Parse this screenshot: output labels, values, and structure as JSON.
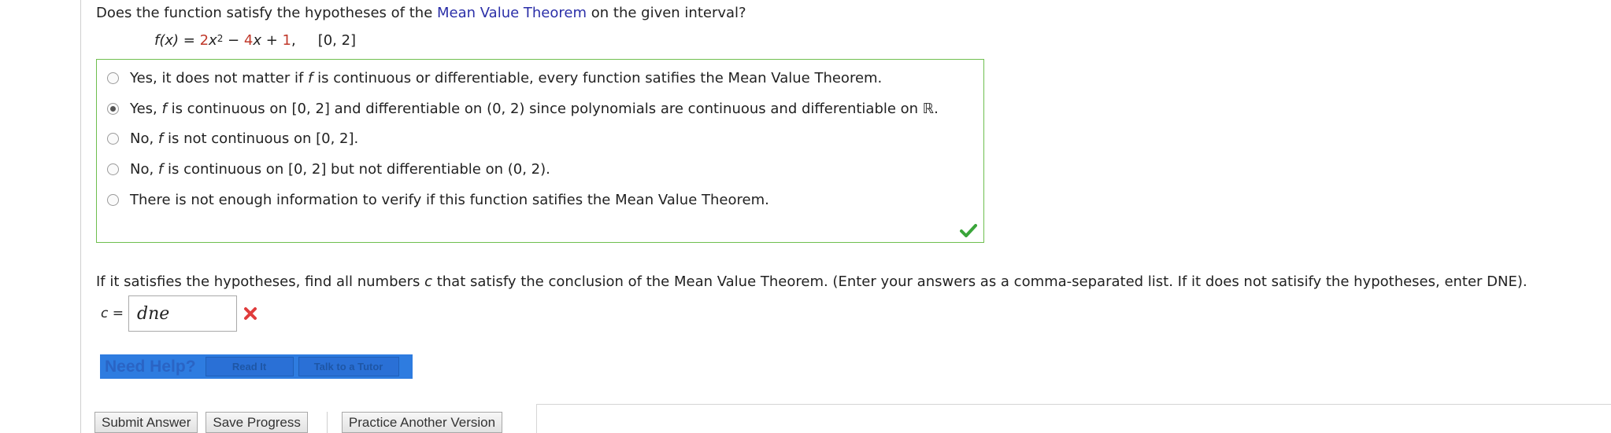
{
  "question": {
    "prefix": "Does the function satisfy the hypotheses of the ",
    "link_text": "Mean Value Theorem",
    "suffix": " on the given interval?"
  },
  "formula": {
    "fx": "f(x)",
    "eq": " = ",
    "coef1": "2",
    "var1": "x",
    "exp": "2",
    "op1": " − ",
    "coef2": "4",
    "var2": "x",
    "op2": " + ",
    "const": "1",
    "comma": ",",
    "interval": "[0, 2]"
  },
  "choices": [
    {
      "pre": "Yes, it does not matter if ",
      "f": "f",
      "post": " is continuous or differentiable, every function satifies the Mean Value Theorem.",
      "selected": false
    },
    {
      "pre": "Yes, ",
      "f": "f",
      "post": " is continuous on [0, 2] and differentiable on (0, 2) since polynomials are continuous and differentiable on ℝ.",
      "selected": true
    },
    {
      "pre": "No, ",
      "f": "f",
      "post": " is not continuous on [0, 2].",
      "selected": false
    },
    {
      "pre": "No, ",
      "f": "f",
      "post": " is continuous on [0, 2] but not differentiable on (0, 2).",
      "selected": false
    },
    {
      "pre": "There is not enough information to verify if this function satifies the Mean Value Theorem.",
      "f": "",
      "post": "",
      "selected": false
    }
  ],
  "part2": {
    "prefix": "If it satisfies the hypotheses, find all numbers ",
    "c": "c",
    "suffix": " that satisfy the conclusion of the Mean Value Theorem. (Enter your answers as a comma-separated list. If it does not satisify the hypotheses, enter DNE).",
    "c_label": "c",
    "eq": " =",
    "answer_value": "dne"
  },
  "help": {
    "title": "Need Help?",
    "read_it": "Read It",
    "talk_tutor": "Talk to a Tutor"
  },
  "buttons": {
    "submit": "Submit Answer",
    "save": "Save Progress",
    "practice": "Practice Another Version"
  },
  "colors": {
    "correct_border": "#6fbf4f",
    "correct_check": "#3aa53a",
    "wrong_x": "#e03c3c",
    "link": "#2b2fa8",
    "help_bar": "#2e7ce0"
  }
}
